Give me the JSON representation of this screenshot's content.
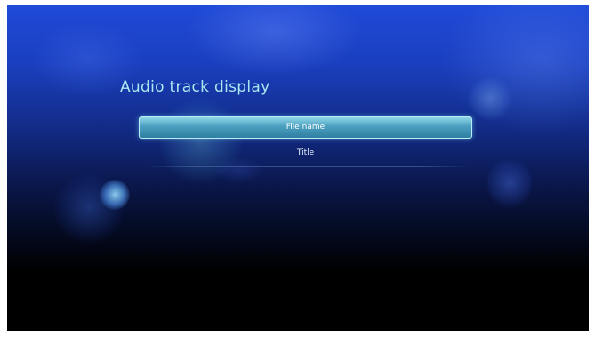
{
  "screen": {
    "title": "Audio track display"
  },
  "options": [
    {
      "label": "File name",
      "selected": true
    },
    {
      "label": "Title",
      "selected": false
    }
  ],
  "colors": {
    "title_text": "#a8e8f0",
    "highlight": "#4a9fbf",
    "background_top": "#1f4ad8",
    "background_bottom": "#000000"
  }
}
